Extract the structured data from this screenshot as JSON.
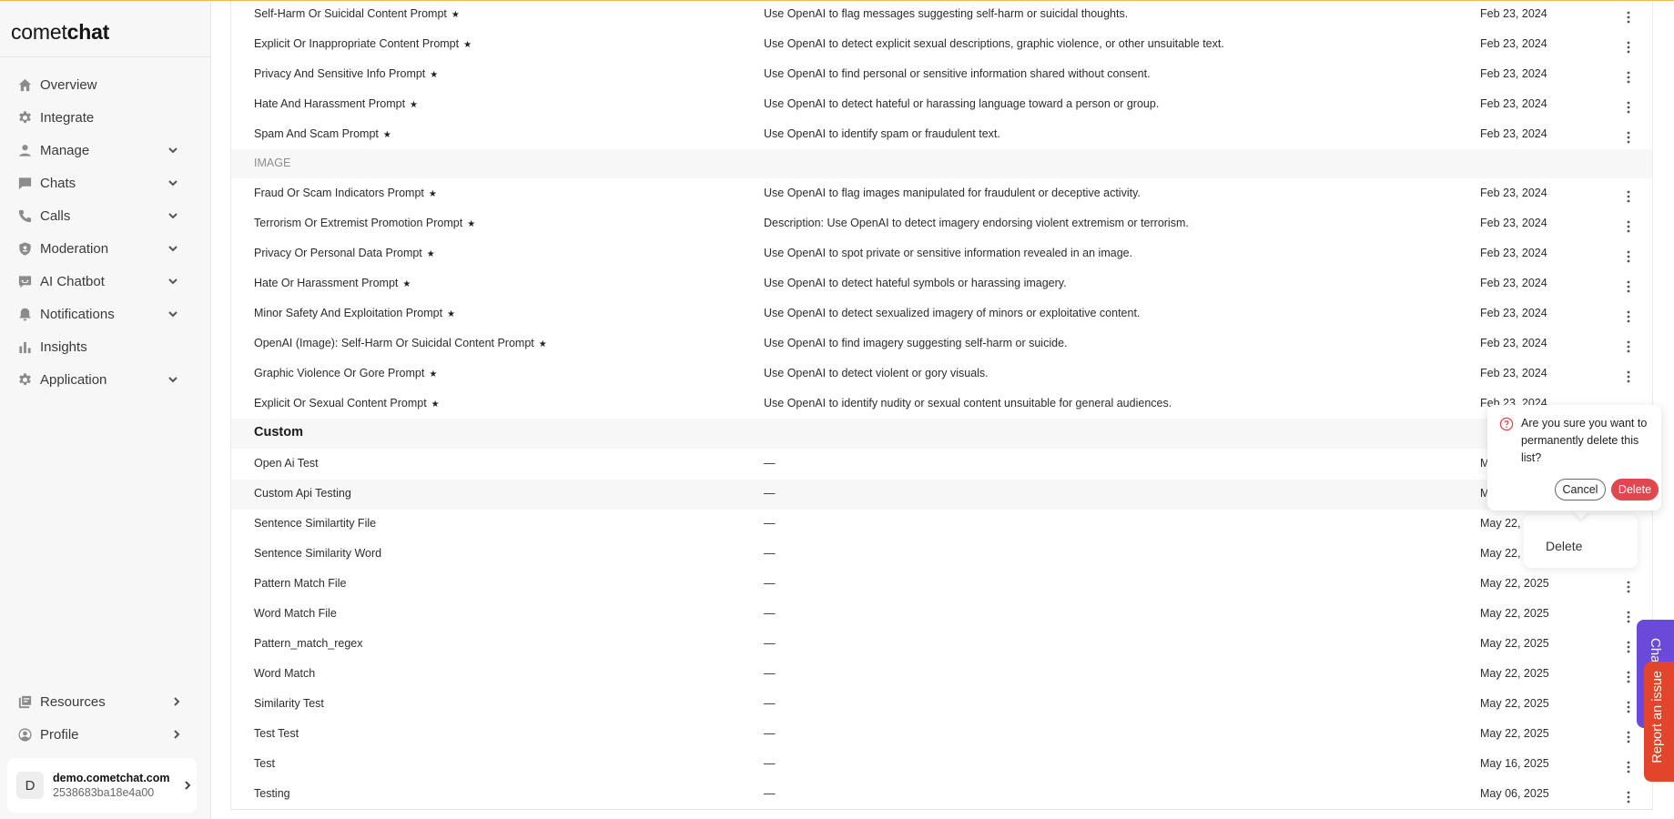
{
  "app": {
    "logo_light": "comet",
    "logo_bold": "chat"
  },
  "sidebar": {
    "items": [
      {
        "label": "Overview",
        "icon": "home-icon",
        "expandable": false
      },
      {
        "label": "Integrate",
        "icon": "gear-icon",
        "expandable": false
      },
      {
        "label": "Manage",
        "icon": "user-icon",
        "expandable": true
      },
      {
        "label": "Chats",
        "icon": "chat-bubble-icon",
        "expandable": true
      },
      {
        "label": "Calls",
        "icon": "phone-icon",
        "expandable": true
      },
      {
        "label": "Moderation",
        "icon": "shield-icon",
        "expandable": true
      },
      {
        "label": "AI Chatbot",
        "icon": "bot-icon",
        "expandable": true
      },
      {
        "label": "Notifications",
        "icon": "bell-icon",
        "expandable": true
      },
      {
        "label": "Insights",
        "icon": "bar-chart-icon",
        "expandable": false
      },
      {
        "label": "Application",
        "icon": "gear-icon",
        "expandable": true
      }
    ],
    "bottom_items": [
      {
        "label": "Resources",
        "icon": "book-icon"
      },
      {
        "label": "Profile",
        "icon": "profile-icon"
      }
    ],
    "account": {
      "initial": "D",
      "name": "demo.cometchat.com",
      "id": "2538683ba18e4a00"
    }
  },
  "table": {
    "text_rows": [
      {
        "name": "Self-Harm Or Suicidal Content Prompt",
        "starred": true,
        "description": "Use OpenAI to flag messages suggesting self-harm or suicidal thoughts.",
        "date": "Feb 23, 2024"
      },
      {
        "name": "Explicit Or Inappropriate Content Prompt",
        "starred": true,
        "description": "Use OpenAI to detect explicit sexual descriptions, graphic violence, or other unsuitable text.",
        "date": "Feb 23, 2024"
      },
      {
        "name": "Privacy And Sensitive Info Prompt",
        "starred": true,
        "description": "Use OpenAI to find personal or sensitive information shared without consent.",
        "date": "Feb 23, 2024"
      },
      {
        "name": "Hate And Harassment Prompt",
        "starred": true,
        "description": "Use OpenAI to detect hateful or harassing language toward a person or group.",
        "date": "Feb 23, 2024"
      },
      {
        "name": "Spam And Scam Prompt",
        "starred": true,
        "description": "Use OpenAI to identify spam or fraudulent text.",
        "date": "Feb 23, 2024"
      }
    ],
    "image_section_label": "IMAGE",
    "image_rows": [
      {
        "name": "Fraud Or Scam Indicators Prompt",
        "starred": true,
        "description": "Use OpenAI to flag images manipulated for fraudulent or deceptive activity.",
        "date": "Feb 23, 2024"
      },
      {
        "name": "Terrorism Or Extremist Promotion Prompt",
        "starred": true,
        "description": "Description: Use OpenAI to detect imagery endorsing violent extremism or terrorism.",
        "date": "Feb 23, 2024"
      },
      {
        "name": "Privacy Or Personal Data Prompt",
        "starred": true,
        "description": "Use OpenAI to spot private or sensitive information revealed in an image.",
        "date": "Feb 23, 2024"
      },
      {
        "name": "Hate Or Harassment Prompt",
        "starred": true,
        "description": "Use OpenAI to detect hateful symbols or harassing imagery.",
        "date": "Feb 23, 2024"
      },
      {
        "name": "Minor Safety And Exploitation Prompt",
        "starred": true,
        "description": "Use OpenAI to detect sexualized imagery of minors or exploitative content.",
        "date": "Feb 23, 2024"
      },
      {
        "name": "OpenAI (Image): Self-Harm Or Suicidal Content Prompt",
        "starred": true,
        "description": "Use OpenAI to find imagery suggesting self-harm or suicide.",
        "date": "Feb 23, 2024"
      },
      {
        "name": "Graphic Violence Or Gore Prompt",
        "starred": true,
        "description": "Use OpenAI to detect violent or gory visuals.",
        "date": "Feb 23, 2024"
      },
      {
        "name": "Explicit Or Sexual Content Prompt",
        "starred": true,
        "description": "Use OpenAI to identify nudity or sexual content unsuitable for general audiences.",
        "date": "Feb 23, 2024"
      }
    ],
    "custom_section_label": "Custom",
    "custom_rows": [
      {
        "name": "Open Ai Test",
        "description": "—",
        "date": "M"
      },
      {
        "name": "Custom Api Testing",
        "description": "—",
        "date": "M"
      },
      {
        "name": "Sentence Similartity File",
        "description": "—",
        "date": "May 22,"
      },
      {
        "name": "Sentence Similarity Word",
        "description": "—",
        "date": "May 22,"
      },
      {
        "name": "Pattern Match File",
        "description": "—",
        "date": "May 22, 2025"
      },
      {
        "name": "Word Match File",
        "description": "—",
        "date": "May 22, 2025"
      },
      {
        "name": "Pattern_match_regex",
        "description": "—",
        "date": "May 22, 2025"
      },
      {
        "name": "Word Match",
        "description": "—",
        "date": "May 22, 2025"
      },
      {
        "name": "Similarity Test",
        "description": "—",
        "date": "May 22, 2025"
      },
      {
        "name": "Test Test",
        "description": "—",
        "date": "May 22, 2025"
      },
      {
        "name": "Test",
        "description": "—",
        "date": "May 16, 2025"
      },
      {
        "name": "Testing",
        "description": "—",
        "date": "May 06, 2025"
      }
    ]
  },
  "popconfirm": {
    "message": "Are you sure you want to permanently delete this list?",
    "cancel_label": "Cancel",
    "confirm_label": "Delete"
  },
  "dropdown": {
    "item_label": "Delete"
  },
  "floating": {
    "chat_label": "Chat",
    "issue_label": "Report an issue"
  },
  "colors": {
    "accent_delete": "#e0474e",
    "chat_tab": "#6a4ad8",
    "issue_tab": "#e2452b",
    "top_line": "#f0b84b"
  }
}
